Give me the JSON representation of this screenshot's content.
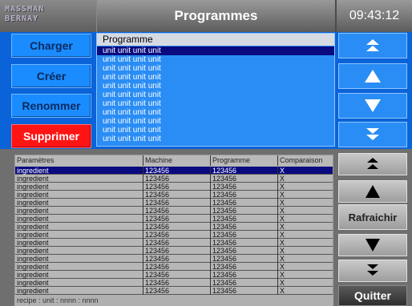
{
  "header": {
    "logo_line1": "MASSMAN",
    "logo_line2": "BERNAY",
    "title": "Programmes",
    "clock": "09:43:12"
  },
  "left_buttons": {
    "load": "Charger",
    "create": "Créer",
    "rename": "Renommer",
    "delete": "Supprimer"
  },
  "program_list": {
    "header": "Programme",
    "rows": [
      "unit unit unit unit",
      "unit unit unit unit",
      "unit unit unit unit",
      "unit unit unit unit",
      "unit unit unit unit",
      "unit unit unit unit",
      "unit unit unit unit",
      "unit unit unit unit",
      "unit unit unit unit",
      "unit unit unit unit",
      "unit unit unit unit"
    ],
    "selected_index": 0
  },
  "table": {
    "columns": [
      "Paramètres",
      "Machine",
      "Programme",
      "Comparaison"
    ],
    "rows": [
      [
        "ingredient",
        "123456",
        "123456",
        "X"
      ],
      [
        "ingredient",
        "123456",
        "123456",
        "X"
      ],
      [
        "ingredient",
        "123456",
        "123456",
        "X"
      ],
      [
        "ingredient",
        "123456",
        "123456",
        "X"
      ],
      [
        "ingredient",
        "123456",
        "123456",
        "X"
      ],
      [
        "ingredient",
        "123456",
        "123456",
        "X"
      ],
      [
        "ingredient",
        "123456",
        "123456",
        "X"
      ],
      [
        "ingredient",
        "123456",
        "123456",
        "X"
      ],
      [
        "ingredient",
        "123456",
        "123456",
        "X"
      ],
      [
        "ingredient",
        "123456",
        "123456",
        "X"
      ],
      [
        "ingredient",
        "123456",
        "123456",
        "X"
      ],
      [
        "ingredient",
        "123456",
        "123456",
        "X"
      ],
      [
        "ingredient",
        "123456",
        "123456",
        "X"
      ],
      [
        "ingredient",
        "123456",
        "123456",
        "X"
      ],
      [
        "ingredient",
        "123456",
        "123456",
        "X"
      ],
      [
        "ingredient",
        "123456",
        "123456",
        "X"
      ]
    ],
    "selected_index": 0
  },
  "status_bar": "recipe : unit : nnnn : nnnn",
  "right_buttons": {
    "refresh": "Rafraichir",
    "quit": "Quitter"
  },
  "colors": {
    "accent_blue": "#0a63d8",
    "button_blue": "#1a8cff",
    "delete_red": "#ff1414",
    "selection_navy": "#0a0a80"
  }
}
